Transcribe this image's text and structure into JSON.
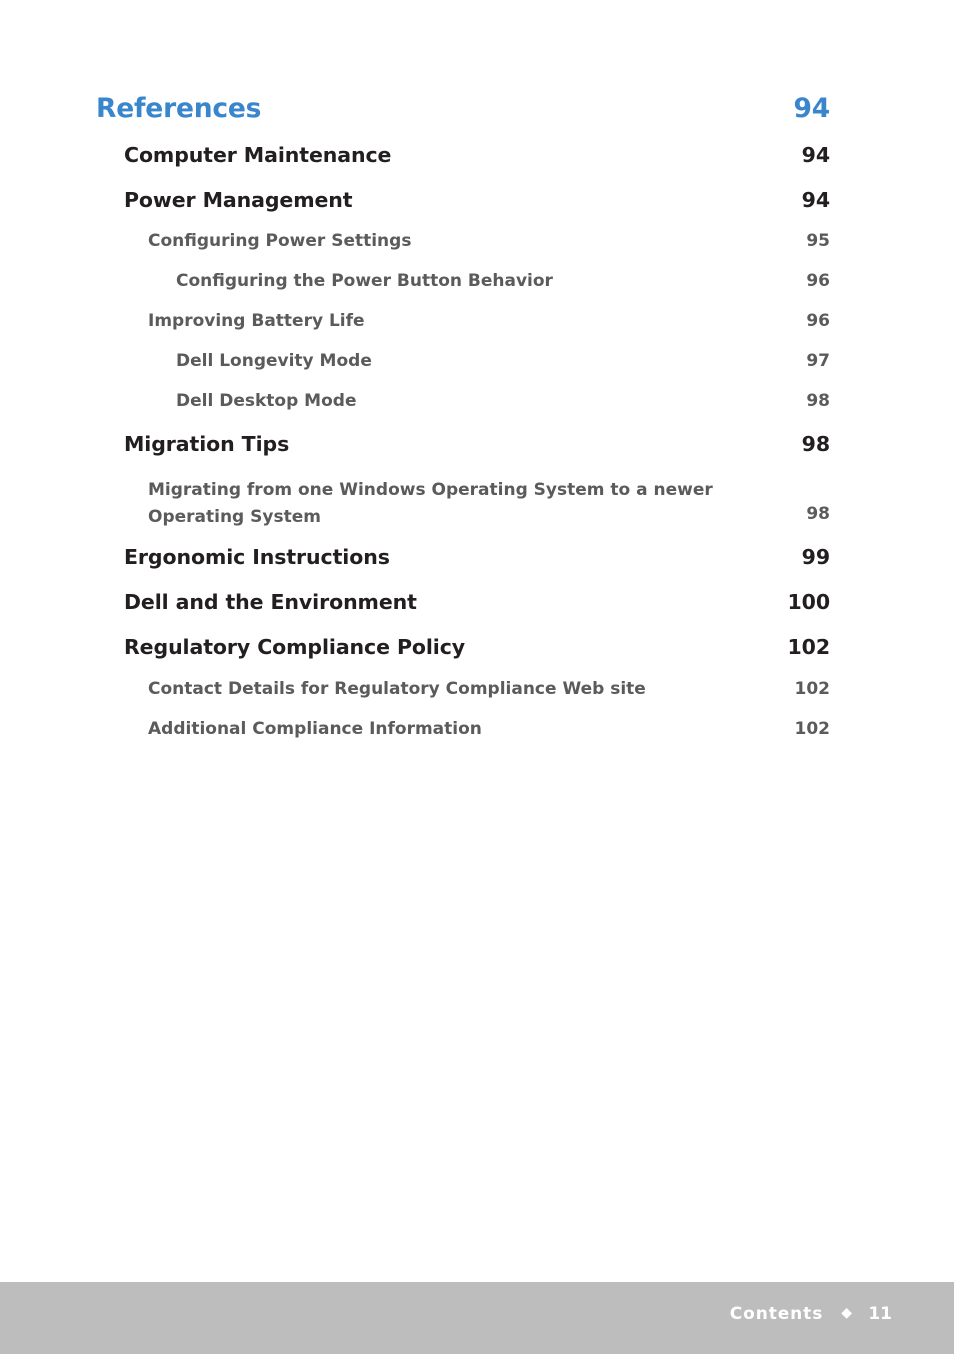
{
  "document": {
    "footer": {
      "label": "Contents",
      "separator_icon": "◆",
      "page_number": "11"
    },
    "colors": {
      "chapter_blue": "#3a86cd",
      "section_black": "#231f20",
      "subsection_gray": "#5b5b5b",
      "footer_bar_gray": "#bdbdbd",
      "footer_text": "#ffffff",
      "page_background": "#ffffff"
    }
  },
  "toc": {
    "entries": [
      {
        "level": 0,
        "title": "References",
        "page": "94"
      },
      {
        "level": 1,
        "title": "Computer Maintenance",
        "page": "94"
      },
      {
        "level": 1,
        "title": "Power Management",
        "page": "94"
      },
      {
        "level": 2,
        "title": "Configuring Power Settings",
        "page": "95"
      },
      {
        "level": 3,
        "title": "Configuring the Power Button Behavior",
        "page": "96"
      },
      {
        "level": 2,
        "title": "Improving Battery Life",
        "page": "96"
      },
      {
        "level": 3,
        "title": "Dell Longevity Mode",
        "page": "97"
      },
      {
        "level": 3,
        "title": "Dell Desktop Mode",
        "page": "98"
      },
      {
        "level": 1,
        "title": "Migration Tips",
        "page": "98"
      },
      {
        "level": 2,
        "title": "Migrating from one Windows Operating System to a newer Operating System",
        "page": "98",
        "wrapped": true
      },
      {
        "level": 1,
        "title": "Ergonomic Instructions",
        "page": "99"
      },
      {
        "level": 1,
        "title": "Dell and the Environment",
        "page": "100"
      },
      {
        "level": 1,
        "title": "Regulatory Compliance Policy",
        "page": "102"
      },
      {
        "level": 2,
        "title": "Contact Details for Regulatory Compliance Web site",
        "page": "102"
      },
      {
        "level": 2,
        "title": "Additional Compliance Information",
        "page": "102"
      }
    ]
  }
}
